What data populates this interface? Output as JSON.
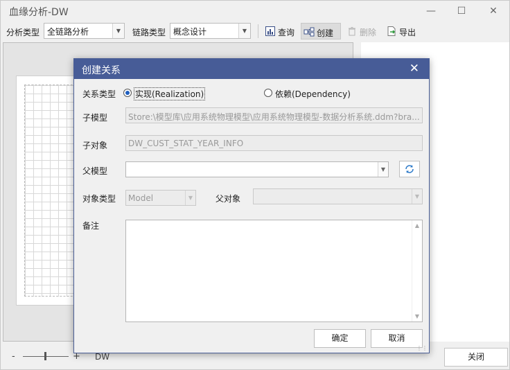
{
  "window": {
    "title": "血缘分析-DW",
    "minimize_icon": "minimize-icon",
    "maximize_icon": "maximize-icon",
    "close_icon": "close-icon"
  },
  "toolbar": {
    "analysis_type_label": "分析类型",
    "analysis_type_value": "全链路分析",
    "link_type_label": "链路类型",
    "link_type_value": "概念设计",
    "query_label": "查询",
    "create_label": "创建",
    "delete_label": "删除",
    "export_label": "导出"
  },
  "statusbar": {
    "zoom_minus": "-",
    "zoom_plus": "+",
    "model_name": "DW",
    "close_label": "关闭"
  },
  "dialog": {
    "title": "创建关系",
    "relation_type_label": "关系类型",
    "radio_realization": "实现(Realization)",
    "radio_dependency": "依赖(Dependency)",
    "selected_relation": "realization",
    "child_model_label": "子模型",
    "child_model_value": "Store:\\模型库\\应用系统物理模型\\应用系统物理模型-数据分析系统.ddm?bra...",
    "child_object_label": "子对象",
    "child_object_value": "DW_CUST_STAT_YEAR_INFO",
    "parent_model_label": "父模型",
    "parent_model_value": "",
    "object_type_label": "对象类型",
    "object_type_value": "Model",
    "parent_object_label": "父对象",
    "parent_object_value": "",
    "remark_label": "备注",
    "remark_value": "",
    "ok_label": "确定",
    "cancel_label": "取消"
  },
  "colors": {
    "dialog_title_bg": "#475c97",
    "radio_selected": "#1f5fbf"
  }
}
